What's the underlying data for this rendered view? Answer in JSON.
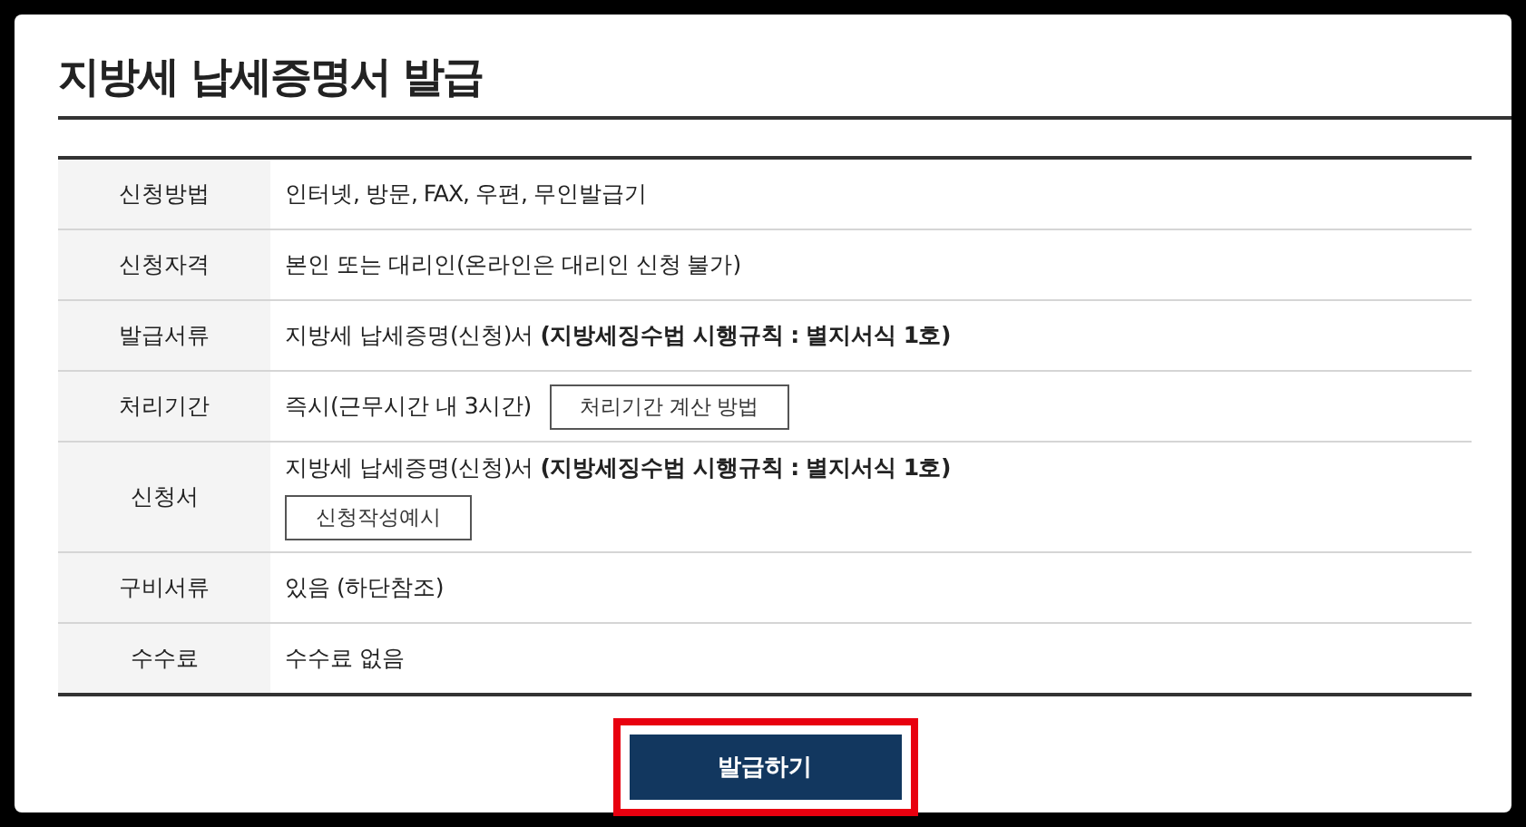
{
  "title": "지방세 납세증명서 발급",
  "rows": [
    {
      "label": "신청방법",
      "kind": "text",
      "value": "인터넷, 방문, FAX, 우편, 무인발급기"
    },
    {
      "label": "신청자격",
      "kind": "text",
      "value": "본인 또는 대리인(온라인은 대리인 신청 불가)"
    },
    {
      "label": "발급서류",
      "kind": "text",
      "value": "지방세 납세증명(신청)서 **(지방세징수법 시행규칙 : 별지서식 1호)**"
    },
    {
      "label": "처리기간",
      "kind": "inline_button",
      "value": "즉시(근무시간 내 3시간)",
      "button": "처리기간 계산 방법"
    },
    {
      "label": "신청서",
      "kind": "block_button",
      "value": "지방세 납세증명(신청)서 **(지방세징수법 시행규칙 : 별지서식 1호)**",
      "button": "신청작성예시"
    },
    {
      "label": "구비서류",
      "kind": "text",
      "value": "있음 (하단참조)"
    },
    {
      "label": "수수료",
      "kind": "text",
      "value": "수수료 없음"
    }
  ],
  "submit": {
    "label": "발급하기",
    "highlighted": true
  }
}
